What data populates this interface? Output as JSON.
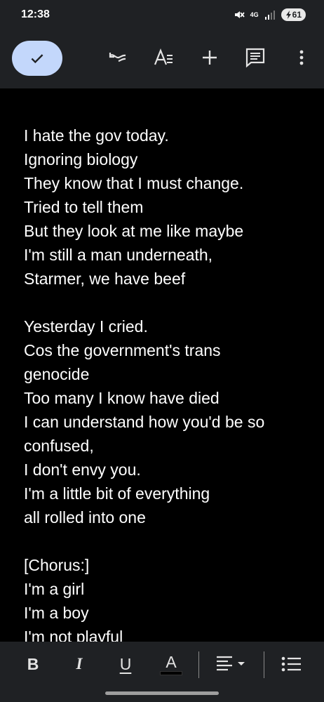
{
  "status_bar": {
    "time": "12:38",
    "network": "4G",
    "battery": "61"
  },
  "toolbar": {
    "icons": [
      "check-icon",
      "undo-icon",
      "text-format-icon",
      "add-icon",
      "comment-icon",
      "more-vert-icon"
    ]
  },
  "document": {
    "lines": [
      "I hate the gov today.",
      "Ignoring biology",
      "They know that I must change.",
      "Tried to tell them",
      "But they look at me like maybe",
      "I'm still a man underneath,",
      "Starmer, we have beef",
      "",
      "Yesterday I cried.",
      "Cos the government's trans",
      "genocide",
      "Too many I know have died",
      "I can understand how you'd be so",
      "confused,",
      "I don't envy you.",
      "I'm a little bit of everything",
      "all rolled into one",
      "",
      "[Chorus:]",
      "I'm a girl",
      "I'm a boy",
      "I'm not playful"
    ]
  },
  "format_bar": {
    "bold": "B",
    "italic": "I",
    "underline": "U",
    "text_color": "A",
    "icons": [
      "bold-icon",
      "italic-icon",
      "underline-icon",
      "text-color-icon",
      "align-icon",
      "list-icon"
    ]
  },
  "colors": {
    "bar_background": "#1f2124",
    "document_background": "#000000",
    "accent": "#c3d7fb"
  }
}
